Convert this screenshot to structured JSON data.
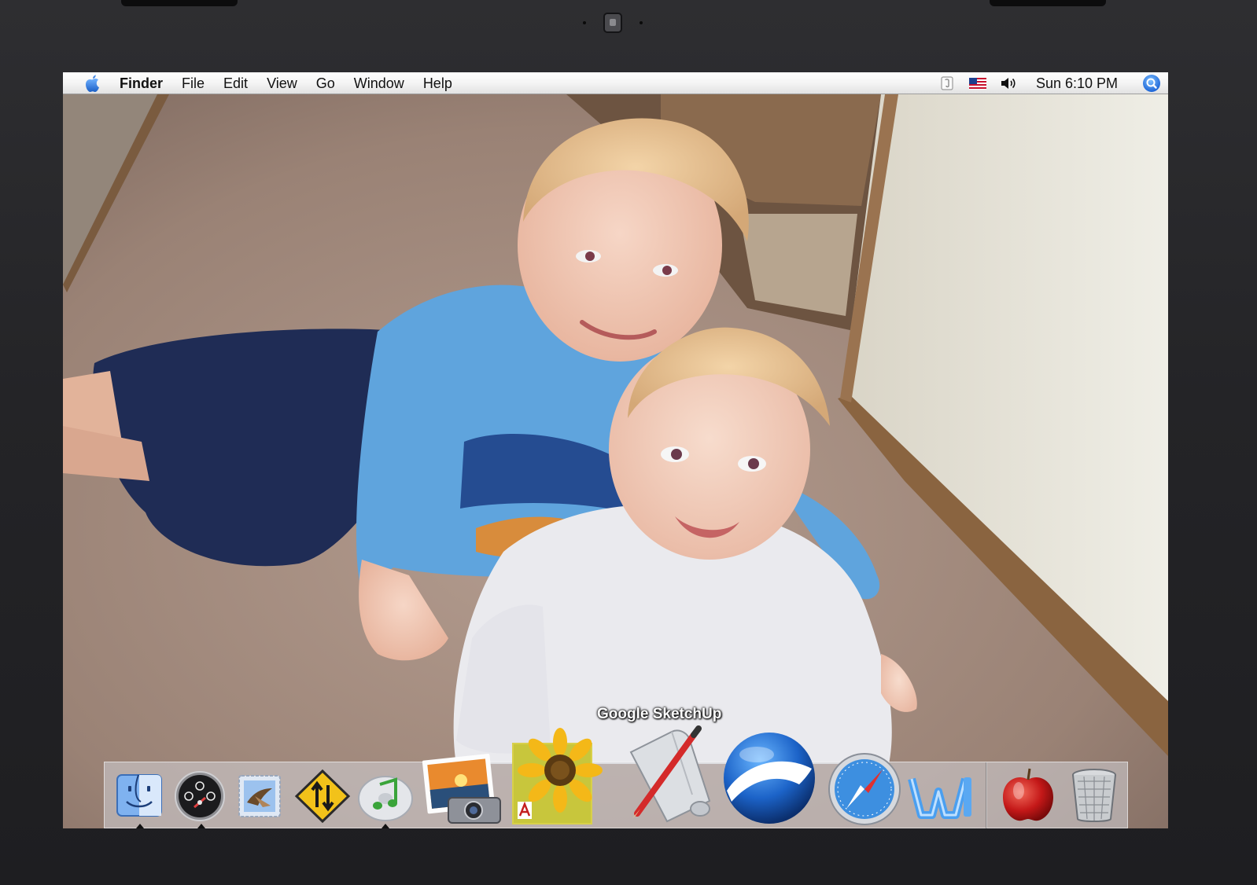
{
  "menubar": {
    "app_name": "Finder",
    "menus": [
      "File",
      "Edit",
      "View",
      "Go",
      "Window",
      "Help"
    ],
    "clock": "Sun 6:10 PM",
    "status_icons": [
      "script-menu-icon",
      "us-flag-input-icon",
      "volume-icon",
      "spotlight-icon"
    ]
  },
  "dock": {
    "hover_label": "Google SketchUp",
    "items": [
      {
        "name": "Finder",
        "icon": "finder-icon",
        "running": true
      },
      {
        "name": "Dashboard",
        "icon": "dashboard-icon",
        "running": true
      },
      {
        "name": "Mail",
        "icon": "mail-icon",
        "running": false
      },
      {
        "name": "Transmit",
        "icon": "transmit-icon",
        "running": false
      },
      {
        "name": "iTunes",
        "icon": "itunes-icon",
        "running": true
      },
      {
        "name": "iPhoto",
        "icon": "iphoto-icon",
        "running": false
      },
      {
        "name": "Adobe Photoshop Elements",
        "icon": "sunflower-icon",
        "running": false
      },
      {
        "name": "Google SketchUp",
        "icon": "sketchup-icon",
        "running": false
      },
      {
        "name": "Google Earth",
        "icon": "google-earth-icon",
        "running": false
      },
      {
        "name": "Safari",
        "icon": "safari-icon",
        "running": false
      },
      {
        "name": "Microsoft Word",
        "icon": "word-icon",
        "running": false
      },
      {
        "name": "Apple",
        "icon": "apple-icon",
        "running": false
      },
      {
        "name": "Trash",
        "icon": "trash-icon",
        "running": false
      }
    ]
  },
  "colors": {
    "menubar_top": "#ffffff",
    "menubar_bottom": "#e2e2e2",
    "apple_blue": "#2f7fe0",
    "bezel": "#242427"
  }
}
